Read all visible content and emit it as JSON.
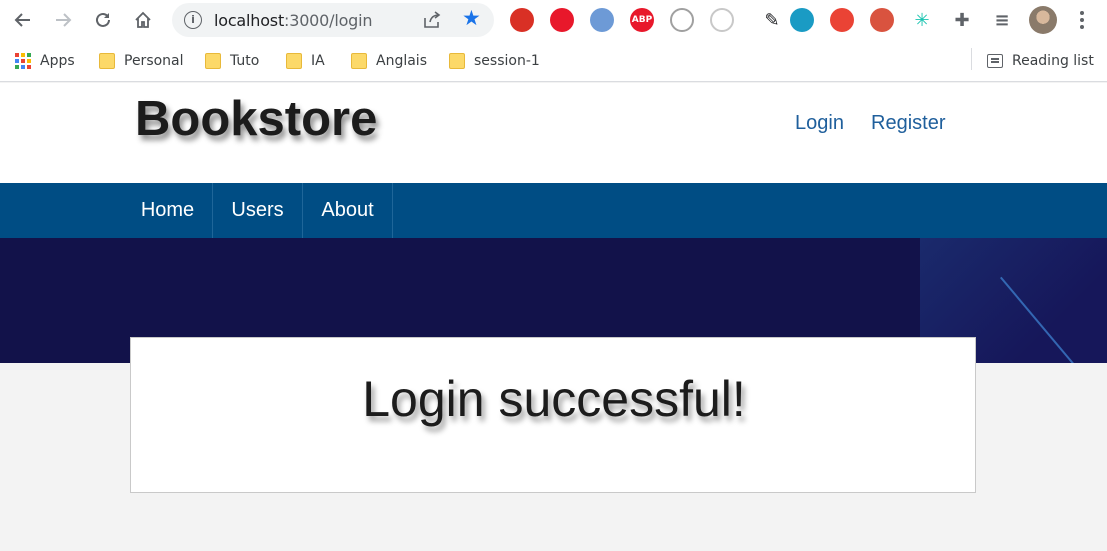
{
  "browser": {
    "url_host": "localhost",
    "url_path": ":3000/login",
    "extensions": [
      {
        "name": "ext-red-icon",
        "color": "#d93025"
      },
      {
        "name": "ext-hand-icon",
        "color": "#e8182b"
      },
      {
        "name": "ext-blue-icon",
        "color": "#6d9ad6"
      },
      {
        "name": "adblock-icon",
        "label": "ABP",
        "color": "#e8182b"
      },
      {
        "name": "ext-gray-icon",
        "color": "#a0a0a0"
      },
      {
        "name": "ext-circle-icon",
        "color": "#c8c8c8"
      },
      {
        "name": "eyedropper-icon",
        "color": "#202124"
      },
      {
        "name": "ext-teal-icon",
        "color": "#1a9bc4"
      },
      {
        "name": "ext-multicolor-icon",
        "color": "#ea4335"
      },
      {
        "name": "ext-react-icon",
        "color": "#d9533f"
      },
      {
        "name": "ext-snowflake-icon",
        "color": "#19c3b0"
      },
      {
        "name": "puzzle-icon",
        "color": "#5f6368"
      },
      {
        "name": "media-icon",
        "color": "#5f6368"
      }
    ]
  },
  "bookmarks": {
    "apps": "Apps",
    "items": [
      "Personal",
      "Tuto",
      "IA",
      "Anglais",
      "session-1"
    ],
    "reading_list": "Reading list"
  },
  "site": {
    "logo": "Bookstore",
    "header_links": [
      "Login",
      "Register"
    ],
    "nav": [
      "Home",
      "Users",
      "About"
    ],
    "message": "Login successful!"
  },
  "colors": {
    "navbar": "#004d84",
    "banner": "#12124a",
    "link": "#1f5f9c"
  }
}
